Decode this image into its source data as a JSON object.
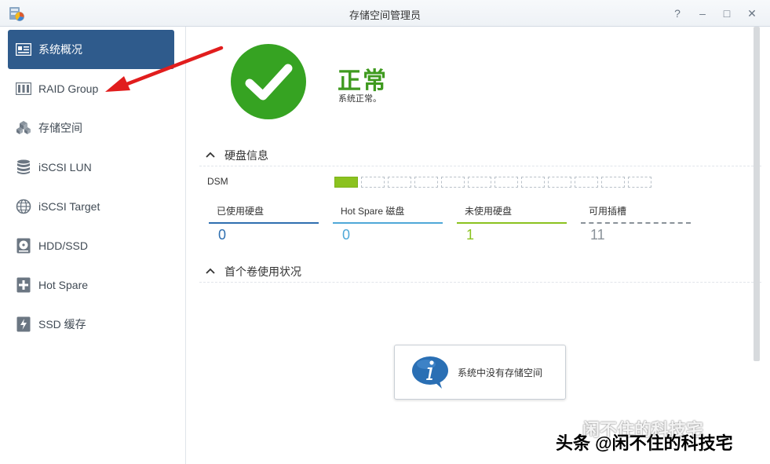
{
  "window": {
    "title": "存储空间管理员"
  },
  "titlebar_buttons": [
    {
      "name": "help-icon",
      "glyph": "?"
    },
    {
      "name": "minimize-icon",
      "glyph": "–"
    },
    {
      "name": "maximize-icon",
      "glyph": "□"
    },
    {
      "name": "close-icon",
      "glyph": "✕"
    }
  ],
  "sidebar": {
    "items": [
      {
        "label": "系统概况",
        "icon": "overview-icon",
        "active": true
      },
      {
        "label": "RAID Group",
        "icon": "raid-group-icon",
        "active": false
      },
      {
        "label": "存储空间",
        "icon": "storage-space-icon",
        "active": false
      },
      {
        "label": "iSCSI LUN",
        "icon": "database-icon",
        "active": false
      },
      {
        "label": "iSCSI Target",
        "icon": "globe-icon",
        "active": false
      },
      {
        "label": "HDD/SSD",
        "icon": "hdd-icon",
        "active": false
      },
      {
        "label": "Hot Spare",
        "icon": "plus-box-icon",
        "active": false
      },
      {
        "label": "SSD 缓存",
        "icon": "ssd-cache-icon",
        "active": false
      }
    ]
  },
  "status": {
    "title": "正常",
    "description": "系统正常。",
    "color": "#36a322"
  },
  "disk_info": {
    "section_title": "硬盘信息",
    "dsm_label": "DSM",
    "slots_used": 1,
    "slots_total": 12,
    "stats": [
      {
        "label": "已使用硬盘",
        "value": "0",
        "color": "#2f6fb0"
      },
      {
        "label": "Hot Spare 磁盘",
        "value": "0",
        "color": "#4fa8d8"
      },
      {
        "label": "未使用硬盘",
        "value": "1",
        "color": "#8bc21f"
      },
      {
        "label": "可用插槽",
        "value": "11",
        "color": "#8a9299"
      }
    ]
  },
  "volume": {
    "section_title": "首个卷使用状况",
    "empty_message": "系统中没有存储空间"
  },
  "watermark": {
    "line1": "闲不住的科技宅",
    "line2": "头条 @闲不住的科技宅"
  }
}
